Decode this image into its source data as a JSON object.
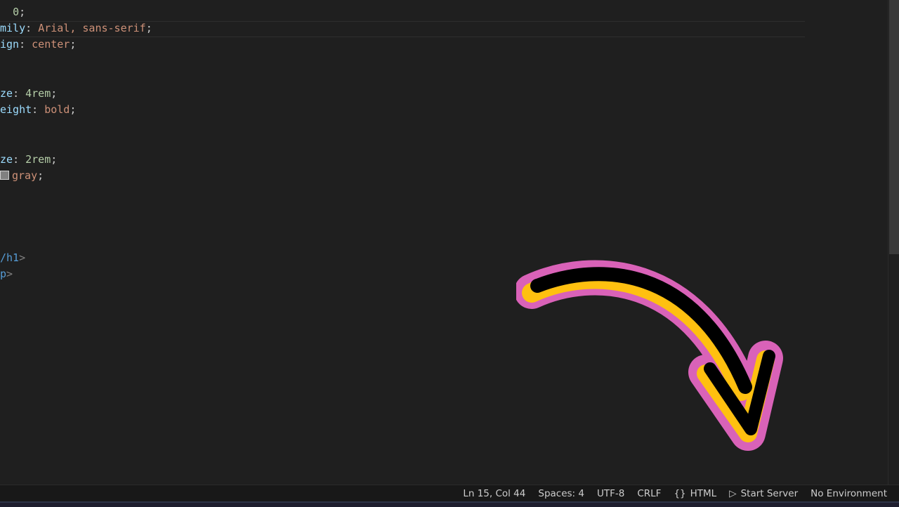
{
  "editor": {
    "lines": [
      {
        "parts": [
          {
            "text": "  ",
            "cls": "punc"
          },
          {
            "text": "0",
            "cls": "num"
          },
          {
            "text": ";",
            "cls": "punc"
          }
        ]
      },
      {
        "parts": [
          {
            "text": "mily",
            "cls": "prop"
          },
          {
            "text": ": ",
            "cls": "punc"
          },
          {
            "text": "Arial, sans-serif",
            "cls": "val"
          },
          {
            "text": ";",
            "cls": "punc"
          }
        ]
      },
      {
        "parts": [
          {
            "text": "ign",
            "cls": "prop"
          },
          {
            "text": ": ",
            "cls": "punc"
          },
          {
            "text": "center",
            "cls": "val"
          },
          {
            "text": ";",
            "cls": "punc"
          }
        ]
      },
      {
        "parts": [
          {
            "text": "ze",
            "cls": "prop"
          },
          {
            "text": ": ",
            "cls": "punc"
          },
          {
            "text": "4rem",
            "cls": "num"
          },
          {
            "text": ";",
            "cls": "punc"
          }
        ]
      },
      {
        "parts": [
          {
            "text": "eight",
            "cls": "prop"
          },
          {
            "text": ": ",
            "cls": "punc"
          },
          {
            "text": "bold",
            "cls": "val"
          },
          {
            "text": ";",
            "cls": "punc"
          }
        ]
      },
      {
        "parts": [
          {
            "text": "ze",
            "cls": "prop"
          },
          {
            "text": ": ",
            "cls": "punc"
          },
          {
            "text": "2rem",
            "cls": "num"
          },
          {
            "text": ";",
            "cls": "punc"
          }
        ]
      },
      {
        "parts": [
          {
            "swatch": "#808080"
          },
          {
            "text": "gray",
            "cls": "val"
          },
          {
            "text": ";",
            "cls": "punc"
          }
        ]
      },
      {
        "parts": [
          {
            "text": "/h1",
            "cls": "tag"
          },
          {
            "text": ">",
            "cls": "tagbr"
          }
        ]
      },
      {
        "parts": [
          {
            "text": "p",
            "cls": "tag"
          },
          {
            "text": ">",
            "cls": "tagbr"
          }
        ]
      }
    ]
  },
  "statusbar": {
    "position": "Ln 15, Col 44",
    "spaces": "Spaces: 4",
    "encoding": "UTF-8",
    "eol": "CRLF",
    "language_icon": "curly-braces-icon",
    "language_glyph": "{}",
    "language": "HTML",
    "server_icon": "play-icon",
    "server_glyph": "▷",
    "server": "Start Server",
    "environment": "No Environment"
  },
  "colors": {
    "background": "#1f1f1f",
    "arrow_outline": "#d962b8",
    "arrow_highlight": "#ffc010",
    "arrow_body": "#000000"
  },
  "overlay": {
    "icon": "curved-arrow-icon"
  }
}
